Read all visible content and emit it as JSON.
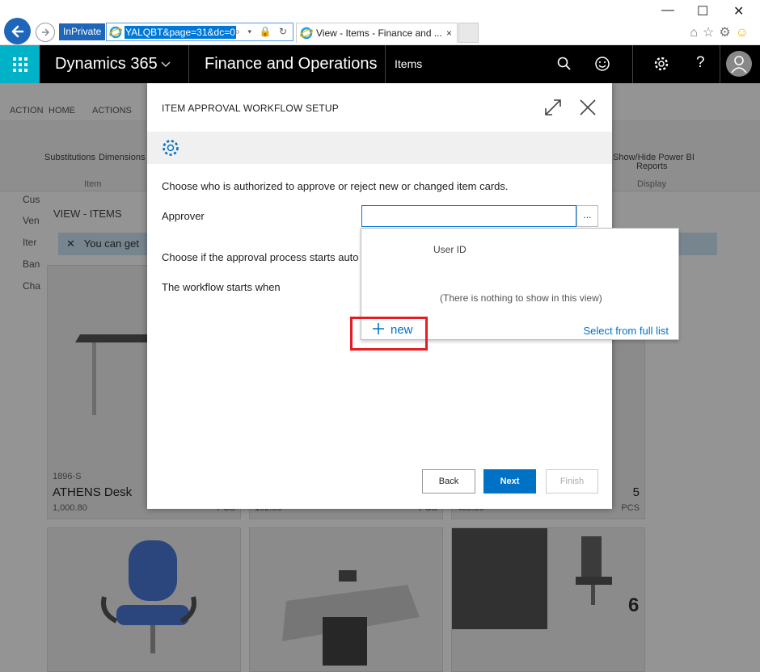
{
  "browser": {
    "inprivate_label": "InPrivate",
    "address_url": "YALQBT&page=31&dc=0",
    "tab_title": "View - Items - Finance and ...",
    "tab_close": "×",
    "address_tools": "⌕ ▾ 🔒 ↻",
    "win_minimize": "—",
    "win_maximize": "☐",
    "win_close": "✕"
  },
  "appbar": {
    "product": "Dynamics 365",
    "module": "Finance and Operations",
    "crumb": "Items"
  },
  "background": {
    "ribbon_tabs": [
      "ACTION",
      "HOME",
      "ACTIONS"
    ],
    "ribbon_buttons": [
      "Substitutions",
      "Dimensions",
      "Show/Hide Power BI",
      "Reports"
    ],
    "ribbon_groups": [
      "Item",
      "Display"
    ],
    "left_nav": [
      "Cus",
      "Ven",
      "Iter",
      "Ban",
      "Cha"
    ],
    "view_label": "VIEW - ITEMS",
    "banner_text": "You can get",
    "card1": {
      "code": "1896-S",
      "title": "ATHENS Desk",
      "price": "1,000.80",
      "unit": "PCS"
    },
    "card2": {
      "price": "192.00",
      "unit": "PCS"
    },
    "card3": {
      "price": "455.00",
      "unit": "PCS"
    },
    "card4": {
      "qty": "5",
      "unit": "PCS"
    },
    "badge6": "6"
  },
  "dialog": {
    "title": "ITEM APPROVAL WORKFLOW SETUP",
    "intro": "Choose who is authorized to approve or reject new or changed item cards.",
    "approver_label": "Approver",
    "approver_value": "",
    "lookup_label": "...",
    "process_label": "Choose if the approval process starts auto",
    "starts_label": "The workflow starts when",
    "back_label": "Back",
    "next_label": "Next",
    "finish_label": "Finish"
  },
  "dropdown": {
    "column_header": "User ID",
    "empty_text": "(There is nothing to show in this view)",
    "new_label": "new",
    "full_list_label": "Select from full list"
  },
  "icons": [
    "back-arrow-icon",
    "forward-arrow-icon",
    "ie-logo-icon",
    "waffle-icon",
    "chevron-down-icon",
    "search-icon",
    "smiley-icon",
    "gear-icon",
    "help-icon",
    "user-icon",
    "expand-icon",
    "close-icon",
    "plus-icon"
  ],
  "colors": {
    "accent": "#0072c6",
    "waffle": "#00b2c8",
    "highlight": "#e51c23",
    "appbar": "#000000"
  }
}
